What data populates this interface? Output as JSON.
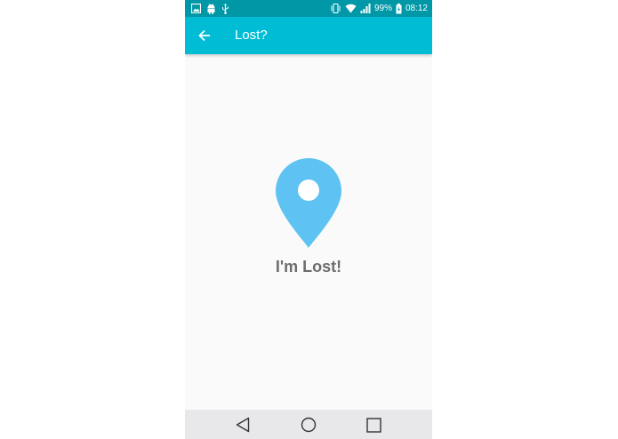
{
  "status_bar": {
    "battery": "99%",
    "time": "08:12",
    "icons": [
      "image-icon",
      "android-icon",
      "usb-icon",
      "vibrate-icon",
      "wifi-icon",
      "signal-icon",
      "battery-charging-icon"
    ]
  },
  "app_bar": {
    "title": "Lost?",
    "back_icon": "arrow-back-icon",
    "color": "#00bcd4",
    "status_color": "#0097a7"
  },
  "main": {
    "pin_icon": "location-pin-icon",
    "pin_color": "#5ec2f2",
    "label": "I'm Lost!"
  },
  "nav_bar": {
    "icons": [
      "back-triangle-icon",
      "home-circle-icon",
      "recents-square-icon"
    ]
  }
}
